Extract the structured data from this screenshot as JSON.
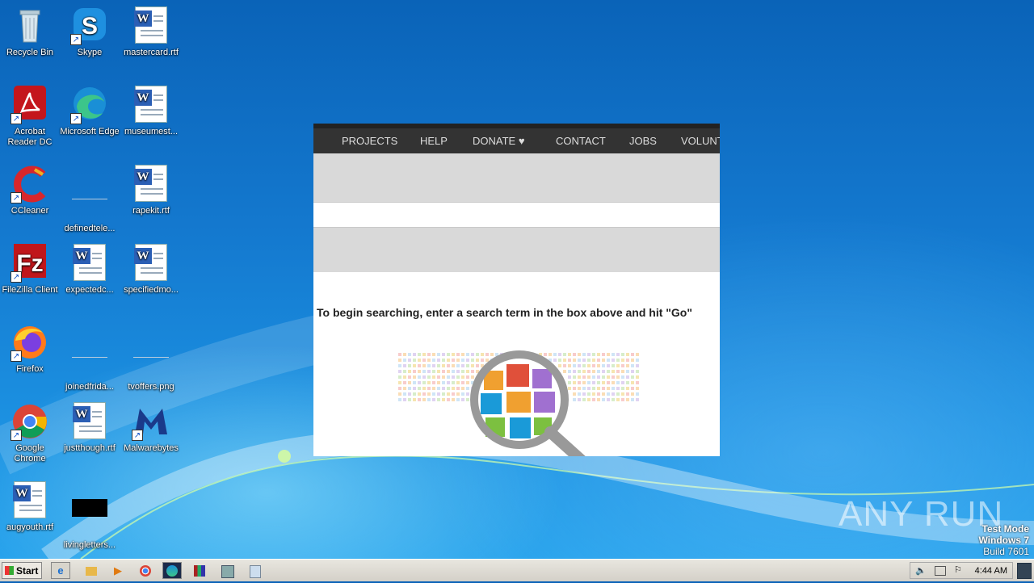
{
  "desktop": {
    "icons": [
      {
        "label": "Recycle Bin",
        "icon": "recycle-bin-icon"
      },
      {
        "label": "Skype",
        "icon": "skype-icon"
      },
      {
        "label": "mastercard.rtf",
        "icon": "word-document-icon"
      },
      {
        "label": "Acrobat Reader DC",
        "icon": "acrobat-icon"
      },
      {
        "label": "Microsoft Edge",
        "icon": "edge-icon"
      },
      {
        "label": "museumest...",
        "icon": "word-document-icon"
      },
      {
        "label": "CCleaner",
        "icon": "ccleaner-icon"
      },
      {
        "label": "definedtele...",
        "icon": "blank-file-icon"
      },
      {
        "label": "rapekit.rtf",
        "icon": "word-document-icon"
      },
      {
        "label": "FileZilla Client",
        "icon": "filezilla-icon"
      },
      {
        "label": "expectedc...",
        "icon": "word-document-icon"
      },
      {
        "label": "specifiedmo...",
        "icon": "word-document-icon"
      },
      {
        "label": "Firefox",
        "icon": "firefox-icon"
      },
      {
        "label": "joinedfrida...",
        "icon": "blank-file-icon"
      },
      {
        "label": "tvoffers.png",
        "icon": "blank-file-icon"
      },
      {
        "label": "Google Chrome",
        "icon": "chrome-icon"
      },
      {
        "label": "justthough.rtf",
        "icon": "word-document-icon"
      },
      {
        "label": "Malwarebytes",
        "icon": "malwarebytes-icon"
      },
      {
        "label": "augyouth.rtf",
        "icon": "word-document-icon"
      },
      {
        "label": "livingletters...",
        "icon": "black-file-icon"
      }
    ]
  },
  "browser": {
    "nav": [
      "PROJECTS",
      "HELP",
      "DONATE",
      "CONTACT",
      "JOBS",
      "VOLUNT"
    ],
    "message": "To begin searching, enter a search term in the box above and hit \"Go\""
  },
  "watermark": {
    "logo": "ANY RUN",
    "line1": "Test Mode",
    "line2": "Windows 7",
    "line3": "Build 7601"
  },
  "taskbar": {
    "start_label": "Start",
    "clock": "4:44 AM",
    "apps": [
      "ie-icon",
      "explorer-icon",
      "media-player-icon",
      "chrome-icon",
      "edge-icon",
      "winrar-icon",
      "installer-icon",
      "notepad-icon"
    ]
  },
  "colors": {
    "desktop_blue": "#1479cf",
    "nav_bg": "#333333",
    "heart": "#e0202a"
  }
}
